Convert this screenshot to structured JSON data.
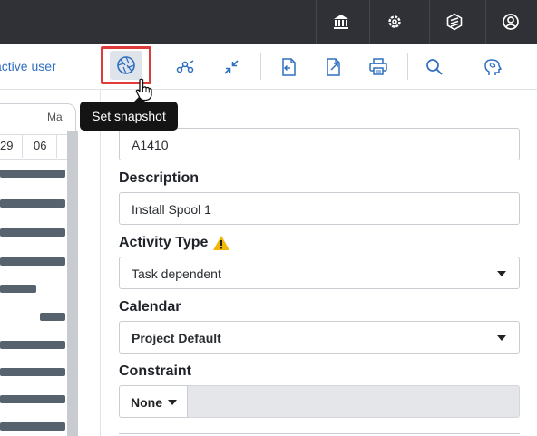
{
  "topbar": {
    "icons": [
      "bank-icon",
      "gear-icon",
      "layers-icon",
      "user-circle-icon"
    ]
  },
  "toolbar": {
    "active_user_text": "active user",
    "tools": [
      "snapshot-icon",
      "network-icon",
      "collapse-icon",
      "import-icon",
      "export-icon",
      "print-icon",
      "search-icon",
      "brain-icon"
    ]
  },
  "tooltip": {
    "text": "Set snapshot"
  },
  "gantt": {
    "month": "Ma",
    "days": [
      "29",
      "06"
    ]
  },
  "form": {
    "id_value": "A1410",
    "description_label": "Description",
    "description_value": "Install Spool 1",
    "activity_type_label": "Activity Type",
    "activity_type_value": "Task dependent",
    "calendar_label": "Calendar",
    "calendar_value": "Project Default",
    "constraint_label": "Constraint",
    "constraint_value": "None"
  },
  "colors": {
    "topbar": "#2f3136",
    "link": "#2f6fc0",
    "icon_blue": "#2f6fc0",
    "highlight": "#e03b3b",
    "warning": "#f2b705",
    "gantt_bar": "#56626e"
  }
}
